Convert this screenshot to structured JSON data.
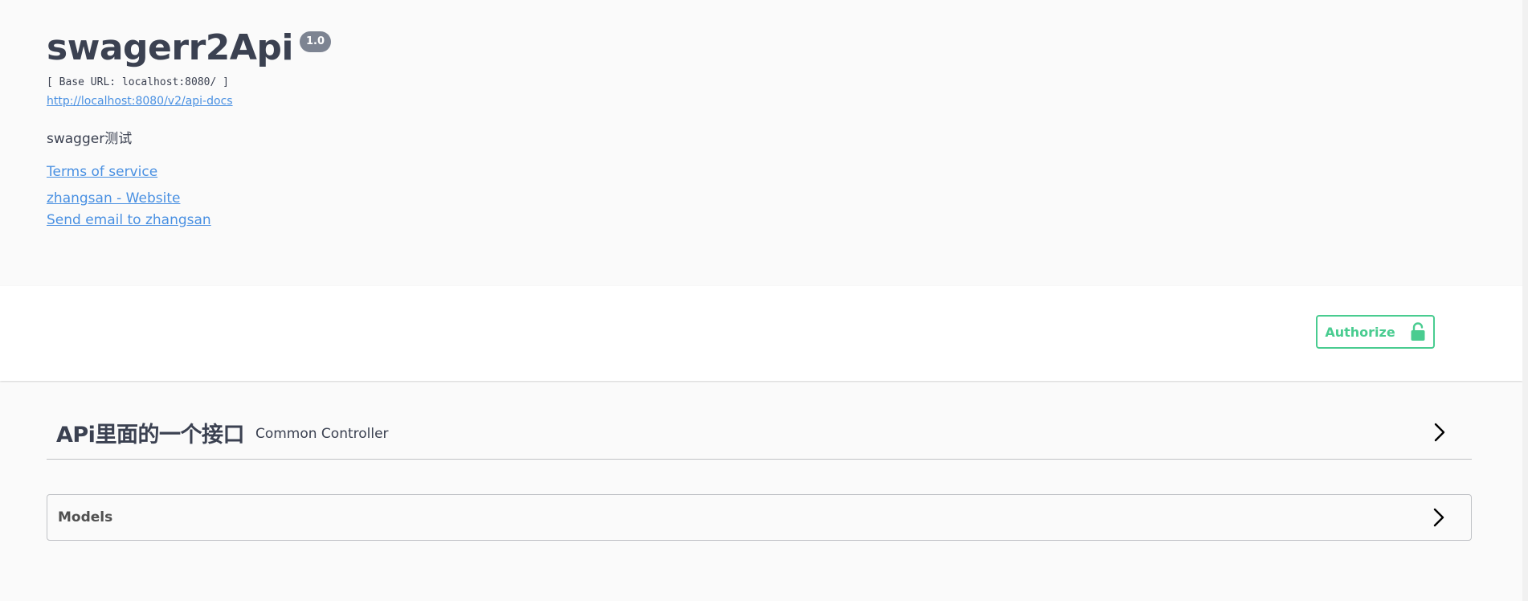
{
  "info": {
    "title": "swagerr2Api",
    "version": "1.0",
    "base_url": "[ Base URL: localhost:8080/ ]",
    "api_docs_url": "http://localhost:8080/v2/api-docs",
    "description": "swagger测试",
    "terms_of_service": "Terms of service",
    "contact_website": "zhangsan - Website",
    "contact_email": "Send email to zhangsan"
  },
  "scheme": {
    "authorize_label": "Authorize",
    "authorize_icon": "unlocked-lock-icon"
  },
  "tags": [
    {
      "name": "APi里面的一个接口",
      "description": "Common Controller",
      "expand_icon": "chevron-right-icon"
    }
  ],
  "models": {
    "label": "Models",
    "expand_icon": "chevron-right-icon"
  },
  "colors": {
    "background": "#fafafa",
    "text": "#3b4151",
    "link": "#4990e2",
    "authorize_green": "#49cc90",
    "version_badge": "#7d8492"
  }
}
